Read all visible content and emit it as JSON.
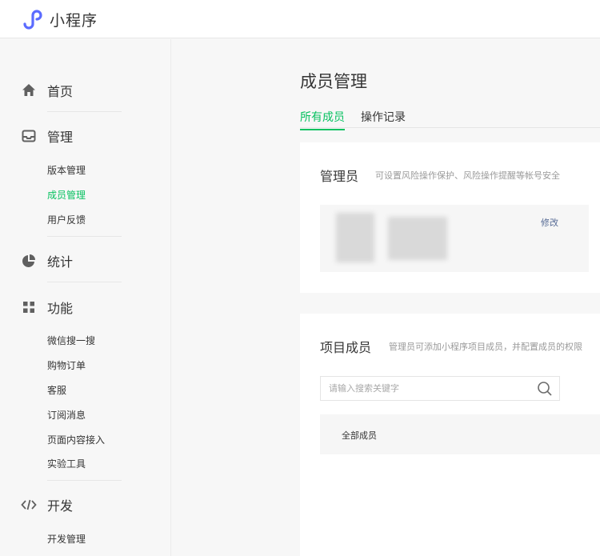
{
  "header": {
    "brand": "小程序"
  },
  "sidebar": {
    "home": "首页",
    "manage": {
      "label": "管理",
      "items": [
        "版本管理",
        "成员管理",
        "用户反馈"
      ]
    },
    "stats": "统计",
    "features": {
      "label": "功能",
      "items": [
        "微信搜一搜",
        "购物订单",
        "客服",
        "订阅消息",
        "页面内容接入",
        "实验工具"
      ]
    },
    "dev": {
      "label": "开发",
      "items": [
        "开发管理"
      ]
    }
  },
  "main": {
    "title": "成员管理",
    "tabs": [
      "所有成员",
      "操作记录"
    ],
    "admin": {
      "title": "管理员",
      "desc": "可设置风险操作保护、风险操作提醒等帐号安全",
      "edit": "修改"
    },
    "members": {
      "title": "项目成员",
      "desc": "管理员可添加小程序项目成员，并配置成员的权限",
      "search_placeholder": "请输入搜索关键字",
      "all_label": "全部成员"
    }
  },
  "colors": {
    "accent": "#07c160",
    "link": "#576b95",
    "logo": "#5b6bff"
  }
}
